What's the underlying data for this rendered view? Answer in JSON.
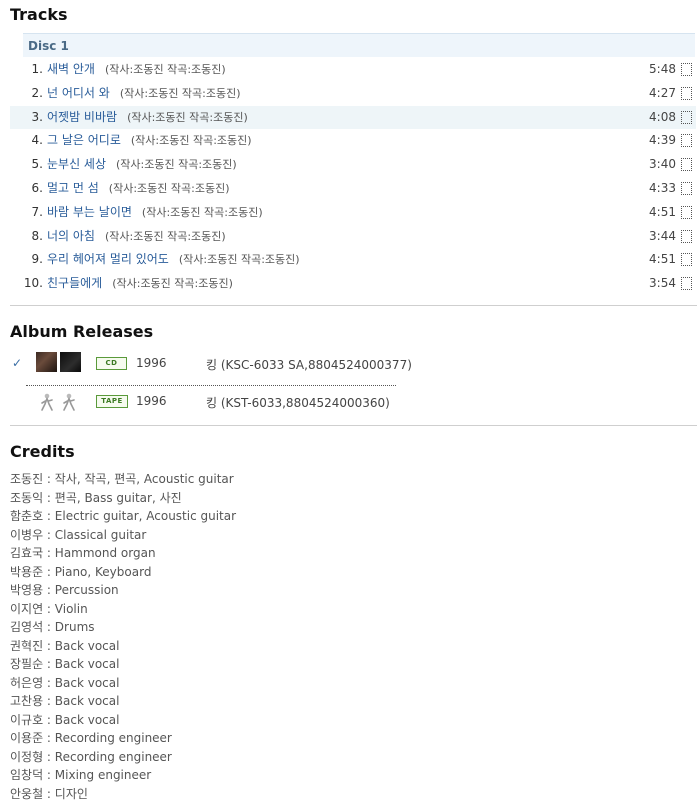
{
  "tracks_section": {
    "title": "Tracks",
    "disc_label": "Disc 1",
    "tracks": [
      {
        "num": "1.",
        "title": "새벽 안개",
        "info": "(작사:조동진 작곡:조동진)",
        "duration": "5:48"
      },
      {
        "num": "2.",
        "title": "넌 어디서 와",
        "info": "(작사:조동진 작곡:조동진)",
        "duration": "4:27"
      },
      {
        "num": "3.",
        "title": "어젯밤 비바람",
        "info": "(작사:조동진 작곡:조동진)",
        "duration": "4:08"
      },
      {
        "num": "4.",
        "title": "그 날은 어디로",
        "info": "(작사:조동진 작곡:조동진)",
        "duration": "4:39"
      },
      {
        "num": "5.",
        "title": "눈부신 세상",
        "info": "(작사:조동진 작곡:조동진)",
        "duration": "3:40"
      },
      {
        "num": "6.",
        "title": "멀고 먼 섬",
        "info": "(작사:조동진 작곡:조동진)",
        "duration": "4:33"
      },
      {
        "num": "7.",
        "title": "바람 부는 날이면",
        "info": "(작사:조동진 작곡:조동진)",
        "duration": "4:51"
      },
      {
        "num": "8.",
        "title": "너의 아침",
        "info": "(작사:조동진 작곡:조동진)",
        "duration": "3:44"
      },
      {
        "num": "9.",
        "title": "우리 헤어져 멀리 있어도",
        "info": "(작사:조동진 작곡:조동진)",
        "duration": "4:51"
      },
      {
        "num": "10.",
        "title": "친구들에게",
        "info": "(작사:조동진 작곡:조동진)",
        "duration": "3:54"
      }
    ]
  },
  "releases_section": {
    "title": "Album Releases",
    "releases": [
      {
        "format": "CD",
        "year": "1996",
        "label": "킹 (KSC-6033 SA,8804524000377)",
        "selected": true,
        "check_icon": "✓"
      },
      {
        "format": "TAPE",
        "year": "1996",
        "label": "킹 (KST-6033,8804524000360)",
        "selected": false
      }
    ]
  },
  "credits_section": {
    "title": "Credits",
    "credits": [
      "조동진 : 작사, 작곡, 편곡, Acoustic guitar",
      "조동익 : 편곡, Bass guitar, 사진",
      "함춘호 : Electric guitar, Acoustic guitar",
      "이병우 : Classical guitar",
      "김효국 : Hammond organ",
      "박용준 : Piano, Keyboard",
      "박영용 : Percussion",
      "이지연 : Violin",
      "김영석 : Drums",
      "권혁진 : Back vocal",
      "장필순 : Back vocal",
      "허은영 : Back vocal",
      "고찬용 : Back vocal",
      "이규호 : Back vocal",
      "이용준 : Recording engineer",
      "이정형 : Recording engineer",
      "임창덕 : Mixing engineer",
      "안웅철 : 디자인"
    ]
  },
  "colors": {
    "link": "#2a5d9a",
    "highlight_row": "#eef5f8",
    "disc_header_bg": "#eef5fb",
    "format_badge": "#3b7a22"
  }
}
